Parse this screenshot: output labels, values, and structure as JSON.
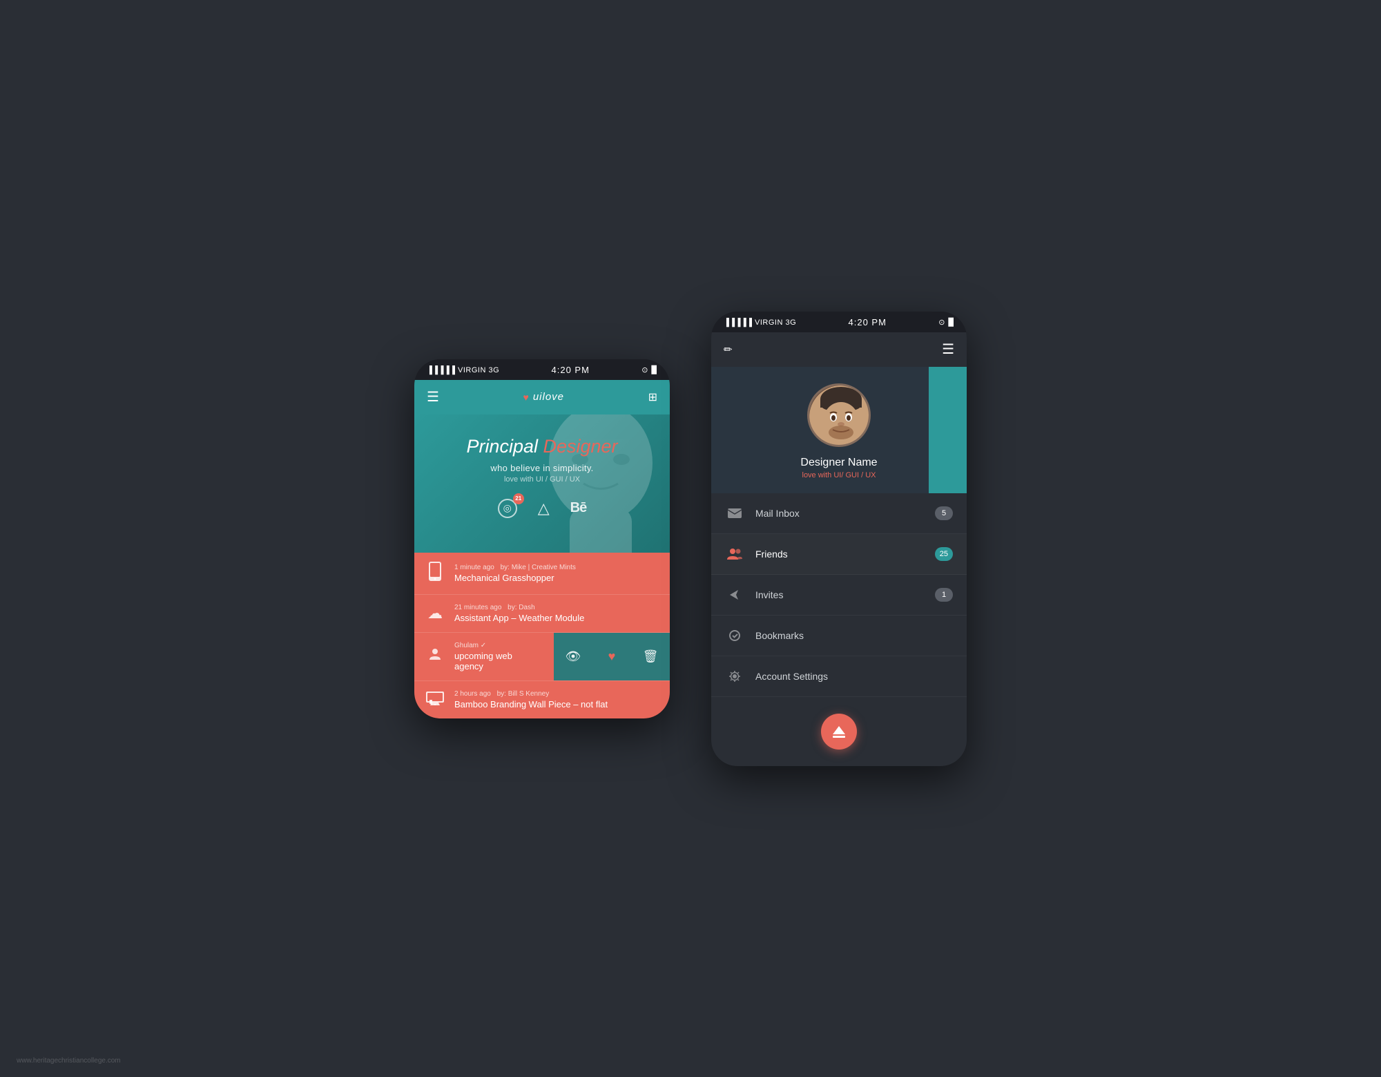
{
  "background_color": "#2a2e35",
  "watermark": "www.heritagechristiancollege.com",
  "phone_left": {
    "status_bar": {
      "signal": "▐▐▐▐▐ VIRGIN  3G",
      "time": "4:20 PM",
      "icons": "⊙ 🔋"
    },
    "header": {
      "menu_label": "☰",
      "logo_text": "uilove",
      "logo_heart": "♥",
      "briefcase_label": "⊞"
    },
    "hero": {
      "line1": "Principal",
      "line2": "Designer",
      "subtitle": "who believe in simplicity.",
      "sub2": "love with UI / GUI / UX"
    },
    "hero_icons": [
      {
        "name": "dribbble",
        "badge": "21",
        "symbol": "◎"
      },
      {
        "name": "artboard",
        "badge": null,
        "symbol": "△"
      },
      {
        "name": "behance",
        "badge": null,
        "symbol": "Bē"
      }
    ],
    "feed": [
      {
        "icon": "📱",
        "time": "1 minute ago",
        "by": "by: Mike | Creative Mints",
        "title": "Mechanical Grasshopper"
      },
      {
        "icon": "☁",
        "time": "21 minutes ago",
        "by": "by: Dash",
        "title": "Assistant App – Weather Module"
      },
      {
        "icon": "👤",
        "time": "Ghulam ✓",
        "by": "",
        "title": "upcoming web agency",
        "swipe": true
      },
      {
        "icon": "🖥",
        "time": "2 hours ago",
        "by": "by: Bill S Kenney",
        "title": "Bamboo Branding  Wall Piece – not flat"
      }
    ],
    "swipe_actions": [
      "👁",
      "♥",
      "🗑"
    ]
  },
  "phone_right": {
    "status_bar": {
      "signal": "▐▐▐▐▐ VIRGIN  3G",
      "time": "4:20 PM",
      "icons": "⊙ 🔋"
    },
    "header": {
      "edit_label": "✏",
      "menu_label": "☰"
    },
    "profile": {
      "name": "Designer Name",
      "subtitle": "love with UI/ GUI / UX"
    },
    "menu_items": [
      {
        "id": "mail",
        "icon": "✉",
        "label": "Mail Inbox",
        "badge": "5",
        "badge_style": "gray",
        "active": false
      },
      {
        "id": "friends",
        "icon": "👥",
        "label": "Friends",
        "badge": "25",
        "badge_style": "teal",
        "active": true
      },
      {
        "id": "invites",
        "icon": "✈",
        "label": "Invites",
        "badge": "1",
        "badge_style": "gray",
        "active": false
      },
      {
        "id": "bookmarks",
        "icon": "✓",
        "label": "Bookmarks",
        "badge": null,
        "active": false
      },
      {
        "id": "settings",
        "icon": "⚙",
        "label": "Account Settings",
        "badge": null,
        "active": false
      }
    ],
    "footer_btn": "⏏"
  }
}
